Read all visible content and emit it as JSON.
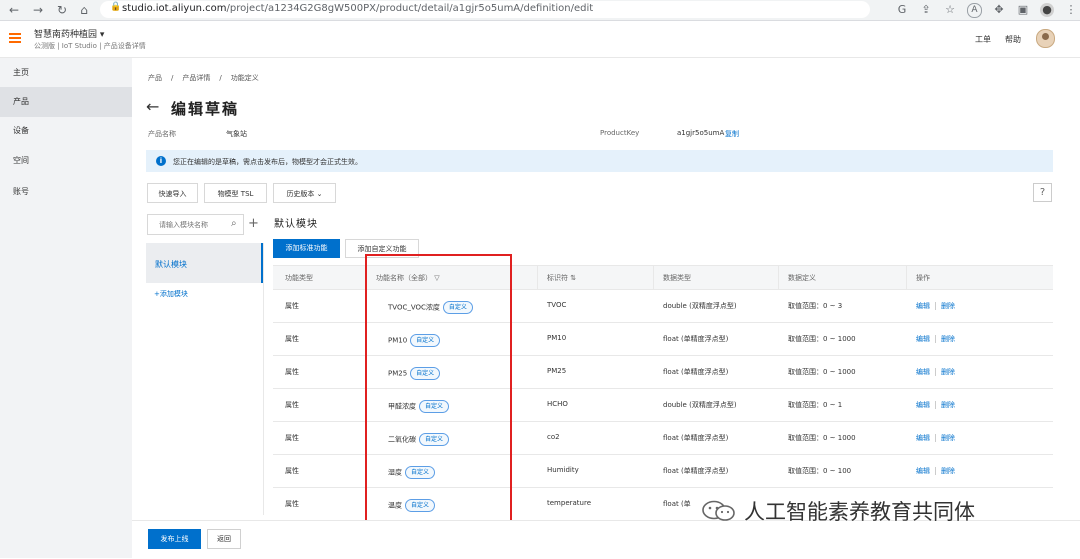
{
  "browser": {
    "url_host": "studio.iot.aliyun.com",
    "url_path": "/project/a1234G2G8gW500PX/product/detail/a1gjr5o5umA/definition/edit"
  },
  "header": {
    "workspace_name": "智慧南药种植园 ▾",
    "workspace_sub": "公测版 | IoT Studio | 产品设备详情",
    "ticket": "工单",
    "help": "帮助"
  },
  "sidebar": {
    "items": [
      {
        "label": "主页"
      },
      {
        "label": "产品"
      },
      {
        "label": "设备"
      },
      {
        "label": "空间"
      },
      {
        "label": "账号"
      }
    ]
  },
  "breadcrumb": [
    "产品",
    "/",
    "产品详情",
    "/",
    "功能定义"
  ],
  "page": {
    "title": "编辑草稿",
    "product_name_label": "产品名称",
    "product_name_value": "气象站",
    "product_key_label": "ProductKey",
    "product_key_value": "a1gjr5o5umA",
    "copy": "复制",
    "notice": "您正在编辑的是草稿，需点击发布后，物模型才会正式生效。"
  },
  "toolbar": {
    "quick_import": "快速导入",
    "tsl": "物模型 TSL",
    "history": "历史版本",
    "help": "?"
  },
  "modules": {
    "search_placeholder": "请输入模块名称",
    "default": "默认模块",
    "add": "+添加模块",
    "section_title": "默认模块",
    "add_std": "添加标准功能",
    "add_custom": "添加自定义功能"
  },
  "table": {
    "headers": [
      "功能类型",
      "功能名称（全部）",
      "标识符 ⇅",
      "数据类型",
      "数据定义",
      "操作"
    ],
    "tag": "自定义",
    "edit": "编辑",
    "delete": "删除",
    "rows": [
      {
        "type": "属性",
        "name": "TVOC_VOC浓度",
        "id": "TVOC",
        "dtype": "double (双精度浮点型)",
        "def": "取值范围：0 ~ 3"
      },
      {
        "type": "属性",
        "name": "PM10",
        "id": "PM10",
        "dtype": "float (单精度浮点型)",
        "def": "取值范围：0 ~ 1000"
      },
      {
        "type": "属性",
        "name": "PM25",
        "id": "PM25",
        "dtype": "float (单精度浮点型)",
        "def": "取值范围：0 ~ 1000"
      },
      {
        "type": "属性",
        "name": "甲醛浓度",
        "id": "HCHO",
        "dtype": "double (双精度浮点型)",
        "def": "取值范围：0 ~ 1"
      },
      {
        "type": "属性",
        "name": "二氧化碳",
        "id": "co2",
        "dtype": "float (单精度浮点型)",
        "def": "取值范围：0 ~ 1000"
      },
      {
        "type": "属性",
        "name": "湿度",
        "id": "Humidity",
        "dtype": "float (单精度浮点型)",
        "def": "取值范围：0 ~ 100"
      },
      {
        "type": "属性",
        "name": "温度",
        "id": "temperature",
        "dtype": "float (单",
        "def": ""
      }
    ]
  },
  "footer": {
    "publish": "发布上线",
    "back": "返回"
  },
  "watermark": "人工智能素养教育共同体",
  "colors": {
    "accent": "#0070cc",
    "brand": "#ff6a00",
    "highlight": "#e02020"
  }
}
